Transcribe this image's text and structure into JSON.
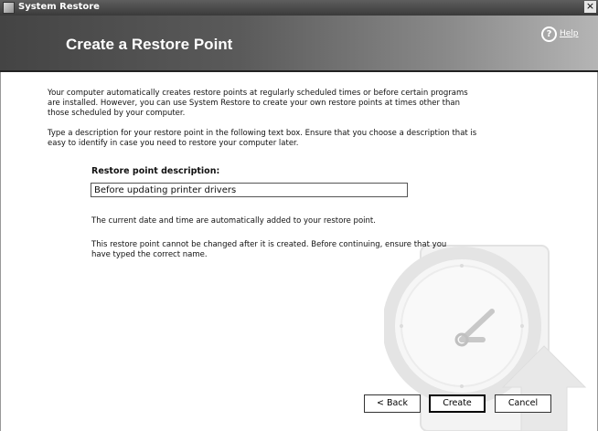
{
  "titlebar": {
    "title": "System Restore",
    "close_glyph": "×"
  },
  "header": {
    "heading": "Create a Restore Point",
    "help_label": "Help",
    "help_glyph": "?"
  },
  "content": {
    "intro": "Your computer automatically creates restore points at regularly scheduled times or before certain programs are installed. However, you can use System Restore to create your own restore points at times other than those scheduled by your computer.",
    "instructions": "Type a description for your restore point in the following text box. Ensure that you choose a description that is easy to identify in case you need to restore your computer later.",
    "field_label": "Restore point description:",
    "field_value": "Before updating printer drivers",
    "note_datetime": "The current date and time are automatically added to your restore point.",
    "note_warning": "This restore point cannot be changed after it is created. Before continuing, ensure that you have typed the correct name."
  },
  "buttons": {
    "back": "< Back",
    "create": "Create",
    "cancel": "Cancel"
  },
  "icons": {
    "app": "system-restore-icon",
    "help": "help-icon",
    "close": "close-icon",
    "background": "restore-clock-arrow-icon"
  }
}
